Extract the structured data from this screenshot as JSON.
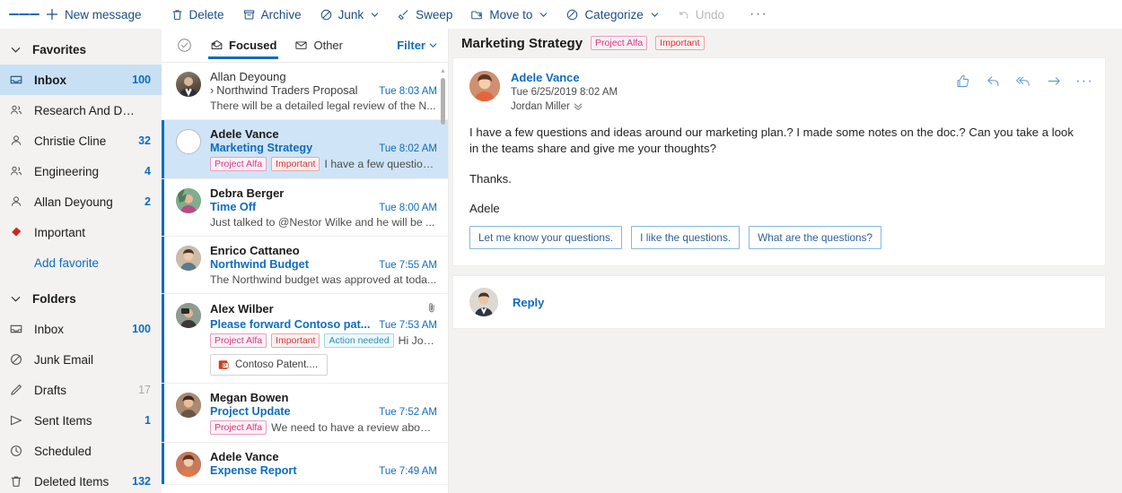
{
  "toolbar": {
    "hamburger": "hamburger-menu",
    "new_message": "New message",
    "delete": "Delete",
    "archive": "Archive",
    "junk": "Junk",
    "sweep": "Sweep",
    "move_to": "Move to",
    "categorize": "Categorize",
    "undo": "Undo",
    "more": "···"
  },
  "sidebar": {
    "favorites": {
      "label": "Favorites",
      "items": [
        {
          "label": "Inbox",
          "count": "100",
          "icon": "inbox-icon",
          "selected": true
        },
        {
          "label": "Research And Deve...",
          "count": "",
          "icon": "group-icon",
          "selected": false
        },
        {
          "label": "Christie Cline",
          "count": "32",
          "icon": "person-icon",
          "selected": false
        },
        {
          "label": "Engineering",
          "count": "4",
          "icon": "group-icon",
          "selected": false
        },
        {
          "label": "Allan Deyoung",
          "count": "2",
          "icon": "person-icon",
          "selected": false
        },
        {
          "label": "Important",
          "count": "",
          "icon": "tag-icon",
          "selected": false
        }
      ],
      "add_favorite": "Add favorite"
    },
    "folders": {
      "label": "Folders",
      "items": [
        {
          "label": "Inbox",
          "count": "100",
          "icon": "inbox-icon",
          "muted": false
        },
        {
          "label": "Junk Email",
          "count": "",
          "icon": "block-icon",
          "muted": false
        },
        {
          "label": "Drafts",
          "count": "17",
          "icon": "pencil-icon",
          "muted": true
        },
        {
          "label": "Sent Items",
          "count": "1",
          "icon": "send-icon",
          "muted": false
        },
        {
          "label": "Scheduled",
          "count": "",
          "icon": "clock-icon",
          "muted": false
        },
        {
          "label": "Deleted Items",
          "count": "132",
          "icon": "trash-icon",
          "muted": false
        }
      ]
    }
  },
  "message_list": {
    "select_all": "select-all-checkbox",
    "pivots": [
      {
        "label": "Focused",
        "active": true
      },
      {
        "label": "Other",
        "active": false
      }
    ],
    "filter": "Filter",
    "items": [
      {
        "from": "Allan Deyoung",
        "subject": "Northwind Traders Proposal",
        "has_chevron": true,
        "time": "Tue 8:03 AM",
        "preview": "There will be a detailed legal review of the N...",
        "tags": [],
        "unread": false,
        "selected": false,
        "attachment": "",
        "has_clip": false
      },
      {
        "from": "Adele Vance",
        "subject": "Marketing Strategy",
        "has_chevron": false,
        "time": "Tue 8:02 AM",
        "preview": "I have a few questions...",
        "tags": [
          {
            "text": "Project Alfa",
            "color": "pink"
          },
          {
            "text": "Important",
            "color": "red"
          }
        ],
        "unread": false,
        "selected": true,
        "attachment": "",
        "has_clip": false
      },
      {
        "from": "Debra Berger",
        "subject": "Time Off",
        "has_chevron": false,
        "time": "Tue 8:00 AM",
        "preview": "Just talked to @Nestor Wilke and he will be ...",
        "tags": [],
        "unread": true,
        "selected": false,
        "attachment": "",
        "has_clip": false
      },
      {
        "from": "Enrico Cattaneo",
        "subject": "Northwind Budget",
        "has_chevron": false,
        "time": "Tue 7:55 AM",
        "preview": "The Northwind budget was approved at toda...",
        "tags": [],
        "unread": true,
        "selected": false,
        "attachment": "",
        "has_clip": false
      },
      {
        "from": "Alex Wilber",
        "subject": "Please forward Contoso pat...",
        "has_chevron": false,
        "time": "Tue 7:53 AM",
        "preview": "Hi Jord...",
        "tags": [
          {
            "text": "Project Alfa",
            "color": "pink"
          },
          {
            "text": "Important",
            "color": "red"
          },
          {
            "text": "Action needed",
            "color": "teal"
          }
        ],
        "unread": true,
        "selected": false,
        "attachment": "Contoso Patent....",
        "has_clip": true
      },
      {
        "from": "Megan Bowen",
        "subject": "Project Update",
        "has_chevron": false,
        "time": "Tue 7:52 AM",
        "preview": "We need to have a review about ...",
        "tags": [
          {
            "text": "Project Alfa",
            "color": "pink"
          }
        ],
        "unread": true,
        "selected": false,
        "attachment": "",
        "has_clip": false
      },
      {
        "from": "Adele Vance",
        "subject": "Expense Report",
        "has_chevron": false,
        "time": "Tue 7:49 AM",
        "preview": "",
        "tags": [],
        "unread": true,
        "selected": false,
        "attachment": "",
        "has_clip": false
      }
    ]
  },
  "reading_pane": {
    "title": "Marketing Strategy",
    "title_tags": [
      {
        "text": "Project Alfa",
        "color": "pink"
      },
      {
        "text": "Important",
        "color": "red"
      }
    ],
    "sender": "Adele Vance",
    "date": "Tue 6/25/2019 8:02 AM",
    "recipients": "Jordan Miller",
    "actions": [
      "like-icon",
      "reply-icon",
      "reply-all-icon",
      "forward-icon",
      "more-icon"
    ],
    "body": [
      "I have a few questions and ideas around our marketing plan.? I made some notes on the doc.? Can you take a look in the teams share and give me your thoughts?",
      "Thanks.",
      "Adele"
    ],
    "suggested_replies": [
      "Let me know your questions.",
      "I like the questions.",
      "What are the questions?"
    ],
    "reply_label": "Reply"
  },
  "colors": {
    "accent": "#0f6cbd",
    "selected_row": "#cfe4f7",
    "sidebar_selected": "#c7e0f4",
    "sidebar_bg": "#f3f2f1",
    "tag_pink": "#d13a7e",
    "tag_red": "#d13438",
    "tag_teal": "#2a8fb5"
  }
}
